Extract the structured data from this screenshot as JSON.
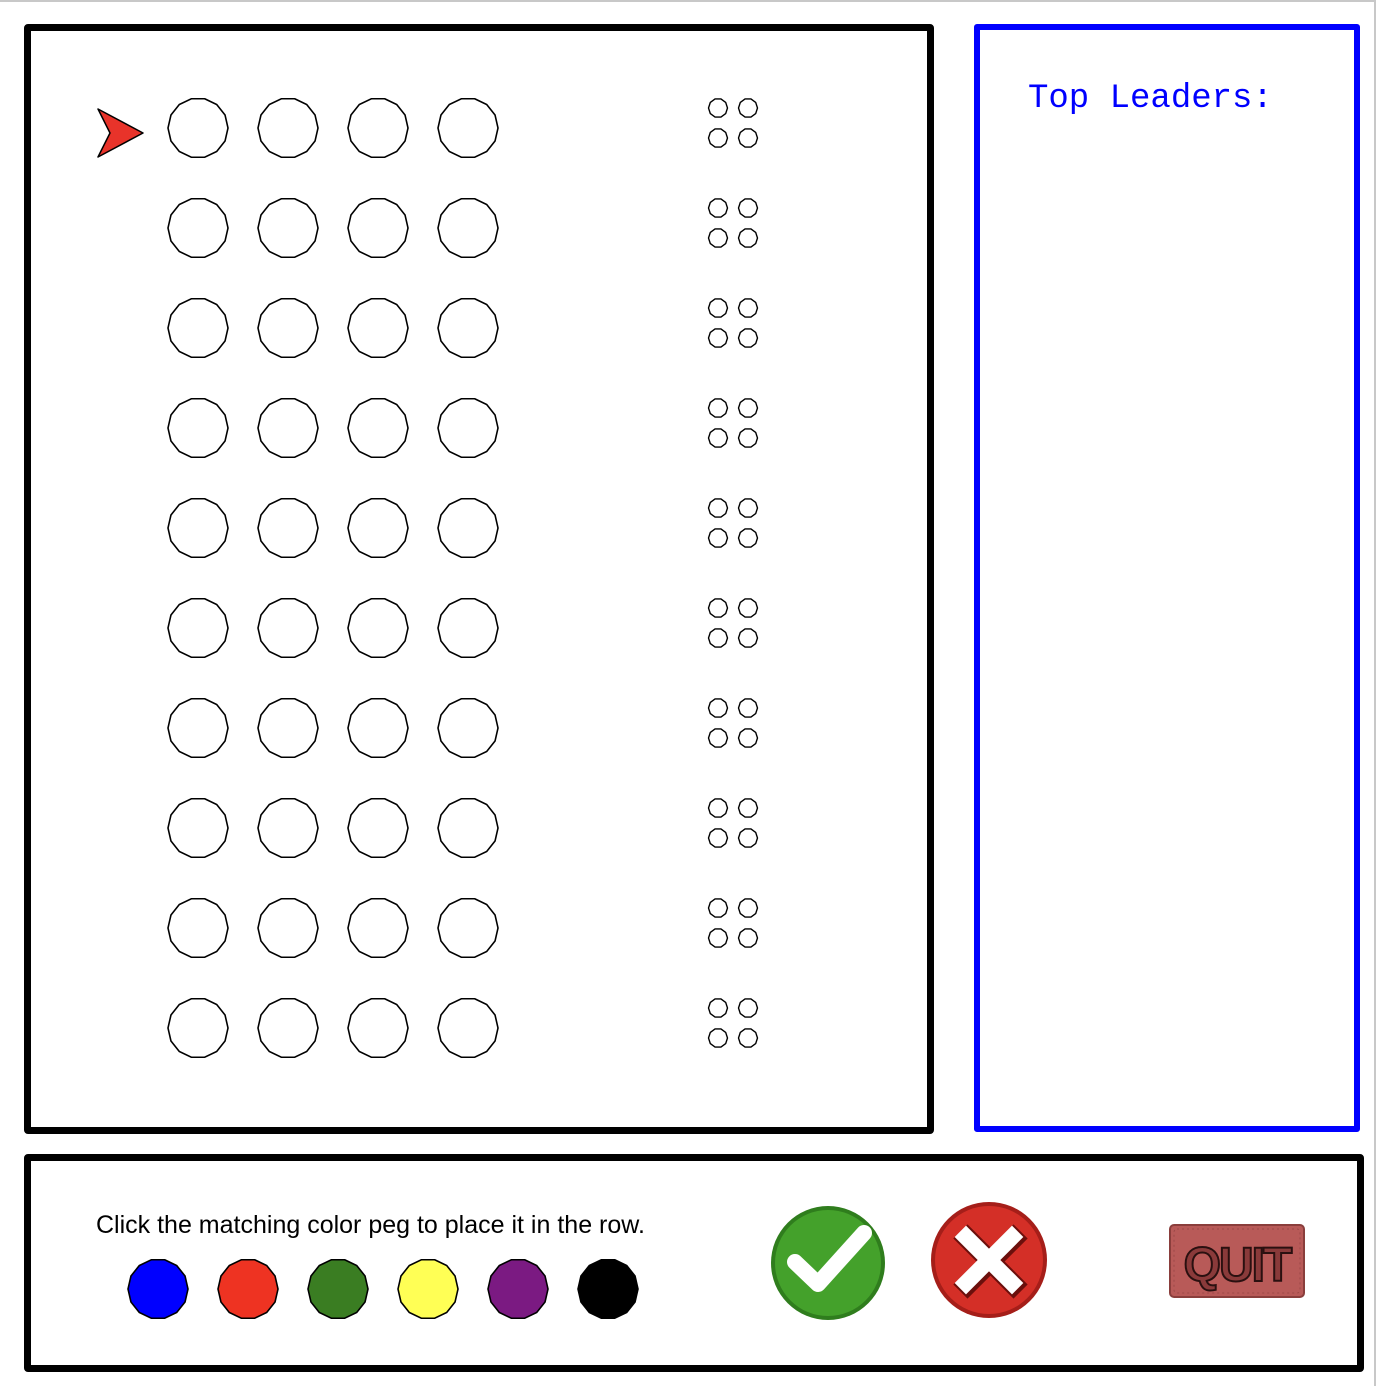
{
  "leaderboard": {
    "title": "Top Leaders:",
    "entries": []
  },
  "board": {
    "guess_rows": 10,
    "pegs_per_row": 4,
    "feedback_pegs_per_row": 4,
    "active_row": 1,
    "row_marker_icon": "red-arrow-icon",
    "row_marker_color": "#e8332a"
  },
  "controls": {
    "instruction": "Click the matching color peg to place it in the row.",
    "palette": [
      {
        "name": "blue",
        "color": "#0000ff"
      },
      {
        "name": "red",
        "color": "#ee3322"
      },
      {
        "name": "green",
        "color": "#3a7d22"
      },
      {
        "name": "yellow",
        "color": "#ffff55"
      },
      {
        "name": "purple",
        "color": "#7b1a82"
      },
      {
        "name": "black",
        "color": "#000000"
      }
    ],
    "submit_icon": "green-check-icon",
    "submit_color": "#44a12b",
    "clear_icon": "red-x-icon",
    "clear_color": "#d42f27",
    "quit_label": "QUIT",
    "quit_color": "#b85a58"
  }
}
